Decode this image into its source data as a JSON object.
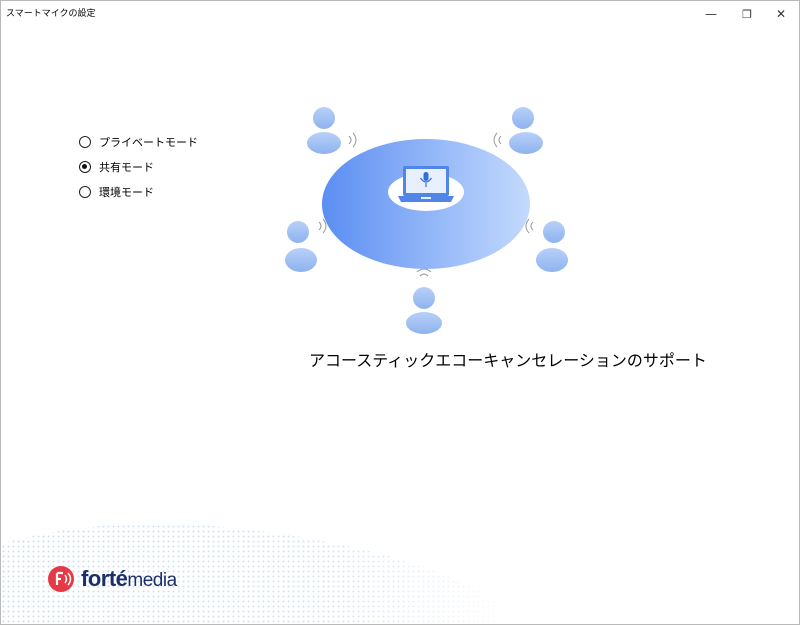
{
  "window": {
    "title": "スマートマイクの設定",
    "controls": {
      "minimize": "—",
      "maximize": "❐",
      "close": "✕"
    }
  },
  "modes": {
    "options": [
      {
        "label": "プライベートモード",
        "selected": false
      },
      {
        "label": "共有モード",
        "selected": true
      },
      {
        "label": "環境モード",
        "selected": false
      }
    ]
  },
  "illustration": {
    "caption": "アコースティックエコーキャンセレーションのサポート",
    "colors": {
      "ellipse_start": "#5b8ef2",
      "ellipse_end": "#c4dafd",
      "person": "#a9c7f5",
      "laptop": "#4f86e8"
    }
  },
  "brand": {
    "name_bold": "forté",
    "name_light": "media",
    "color": "#1d2f6b",
    "accent": "#e63946"
  }
}
